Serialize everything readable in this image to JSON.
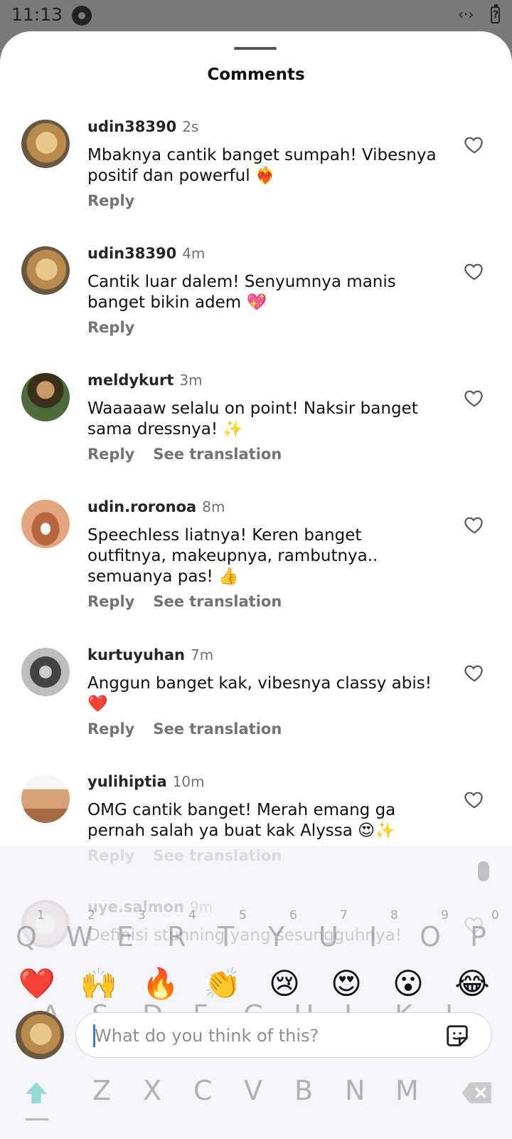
{
  "status": {
    "time": "11:13",
    "code_glyph": "‹·›"
  },
  "sheet": {
    "title": "Comments"
  },
  "comments": [
    {
      "user": "udin38390",
      "time": "2s",
      "text": "Mbaknya cantik banget sumpah! Vibesnya positif dan powerful ❤️‍🔥",
      "reply": "Reply",
      "translate": ""
    },
    {
      "user": "udin38390",
      "time": "4m",
      "text": "Cantik luar dalem! Senyumnya manis banget bikin adem 💖",
      "reply": "Reply",
      "translate": ""
    },
    {
      "user": "meldykurt",
      "time": "3m",
      "text": "Waaaaaw selalu on point! Naksir banget sama dressnya! ✨",
      "reply": "Reply",
      "translate": "See translation"
    },
    {
      "user": "udin.roronoa",
      "time": "8m",
      "text": "Speechless liatnya! Keren banget outfitnya, makeupnya, rambutnya.. semuanya pas! 👍",
      "reply": "Reply",
      "translate": "See translation"
    },
    {
      "user": "kurtuyuhan",
      "time": "7m",
      "text": "Anggun banget kak, vibesnya classy abis! ❤️",
      "reply": "Reply",
      "translate": "See translation"
    },
    {
      "user": "yulihiptia",
      "time": "10m",
      "text": "OMG cantik banget! Merah emang ga pernah salah ya buat kak Alyssa 😍✨",
      "reply": "Reply",
      "translate": "See translation"
    },
    {
      "user": "uye.salmon",
      "time": "9m",
      "text": "Definisi stunning yang sesungguhnya!",
      "reply": "",
      "translate": ""
    }
  ],
  "keyboard_ghost": {
    "numbers": [
      "1",
      "2",
      "3",
      "4",
      "5",
      "6",
      "7",
      "8",
      "9",
      "0"
    ],
    "row1": [
      "Q",
      "W",
      "E",
      "R",
      "T",
      "Y",
      "U",
      "I",
      "O",
      "P"
    ],
    "row2": [
      "A",
      "S",
      "D",
      "F",
      "G",
      "H",
      "J",
      "K",
      "L"
    ],
    "row3": [
      "Z",
      "X",
      "C",
      "V",
      "B",
      "N",
      "M"
    ]
  },
  "reactions": [
    "❤️",
    "🙌",
    "🔥",
    "👏",
    "😢",
    "😍",
    "😮",
    "😂"
  ],
  "composer": {
    "placeholder": "What do you think of this?",
    "value": ""
  },
  "icons": {
    "heart": "heart-icon",
    "sticker": "sticker-icon",
    "shift": "shift-icon",
    "backspace": "backspace-icon",
    "mic": "mic-icon"
  },
  "colors": {
    "muted_text": "#737373",
    "caret": "#3a7be0"
  }
}
